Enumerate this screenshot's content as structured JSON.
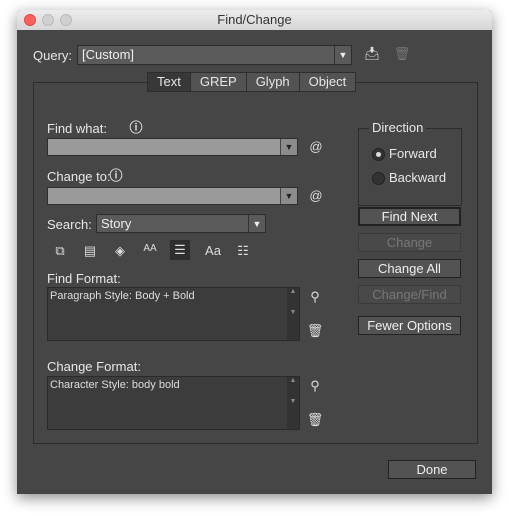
{
  "window": {
    "title": "Find/Change"
  },
  "query": {
    "label": "Query:",
    "value": "[Custom]"
  },
  "tabs": [
    {
      "label": "Text"
    },
    {
      "label": "GREP"
    },
    {
      "label": "Glyph"
    },
    {
      "label": "Object"
    }
  ],
  "find_what": {
    "label": "Find what:",
    "value": ""
  },
  "change_to": {
    "label": "Change to:",
    "value": ""
  },
  "search": {
    "label": "Search:",
    "value": "Story"
  },
  "direction": {
    "label": "Direction",
    "options": [
      "Forward",
      "Backward"
    ],
    "selected": "Forward"
  },
  "buttons": {
    "find_next": "Find Next",
    "change": "Change",
    "change_all": "Change All",
    "change_find": "Change/Find",
    "fewer_options": "Fewer Options",
    "done": "Done"
  },
  "find_format": {
    "label": "Find Format:",
    "value": "Paragraph Style: Body + Bold"
  },
  "change_format": {
    "label": "Change Format:",
    "value": "Character Style: body bold"
  },
  "options_icons": {
    "case": "Aa"
  }
}
